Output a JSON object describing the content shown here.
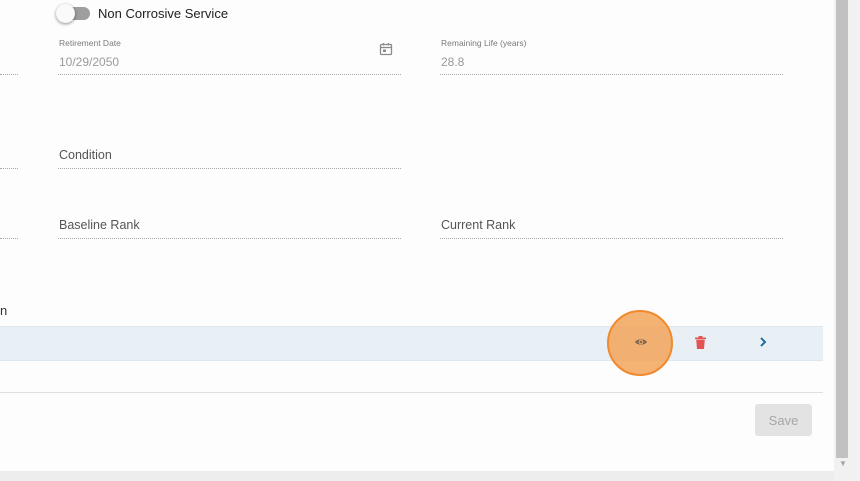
{
  "toggle": {
    "label": "Non Corrosive Service",
    "on": false
  },
  "retirement_date": {
    "label": "Retirement Date",
    "value": "10/29/2050"
  },
  "remaining_life": {
    "label": "Remaining Life (years)",
    "value": "28.8"
  },
  "condition": {
    "label": "Condition"
  },
  "baseline_rank": {
    "label": "Baseline Rank"
  },
  "current_rank": {
    "label": "Current Rank"
  },
  "section_fragment": "n",
  "row_actions": {
    "icons": [
      "eye-icon",
      "trash-icon",
      "chevron-right-icon"
    ]
  },
  "footer": {
    "save_label": "Save"
  },
  "colors": {
    "delete": "#e55353",
    "chevron": "#1f6f9e",
    "click_marker": "#ef8a2e",
    "row_highlight": "#e8f0f6"
  }
}
